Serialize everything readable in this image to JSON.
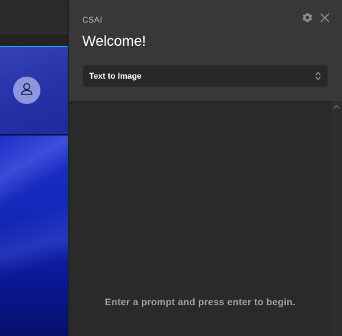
{
  "panel": {
    "app_name": "CSAI",
    "welcome": "Welcome!",
    "mode_select": {
      "selected": "Text to Image"
    },
    "empty_hint": "Enter a prompt and press enter to begin."
  },
  "icons": {
    "settings": "gear-icon",
    "close": "close-icon",
    "select": "chevron-up-down-icon",
    "avatar": "user-icon",
    "scroll_up": "chevron-up-icon"
  },
  "colors": {
    "panel_bg": "#2a2a2a",
    "header_bg": "#383838",
    "accent": "#2f8fe6",
    "hint_text": "#a3a3a3"
  }
}
